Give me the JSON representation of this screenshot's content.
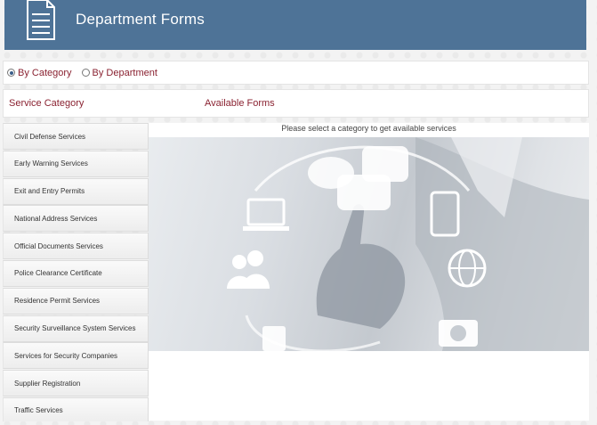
{
  "header": {
    "title": "Department Forms",
    "icon": "document-icon",
    "background_color": "#4e7397"
  },
  "filter": {
    "options": [
      {
        "label": "By Category",
        "selected": true
      },
      {
        "label": "By Department",
        "selected": false
      }
    ]
  },
  "columns": {
    "service_category": "Service Category",
    "available_forms": "Available Forms"
  },
  "categories": [
    {
      "label": "Civil Defense Services"
    },
    {
      "label": "Early Warning Services"
    },
    {
      "label": "Exit and Entry Permits"
    },
    {
      "label": "National Address Services"
    },
    {
      "label": "Official Documents Services"
    },
    {
      "label": "Police Clearance Certificate"
    },
    {
      "label": "Residence Permit Services"
    },
    {
      "label": "Security Surveillance System Services"
    },
    {
      "label": "Services for Security Companies"
    },
    {
      "label": "Supplier Registration"
    },
    {
      "label": "Traffic Services"
    }
  ],
  "forms_panel": {
    "message": "Please select a category to get available services"
  },
  "colors": {
    "accent_text": "#8a2231",
    "header_bg": "#4e7397"
  }
}
